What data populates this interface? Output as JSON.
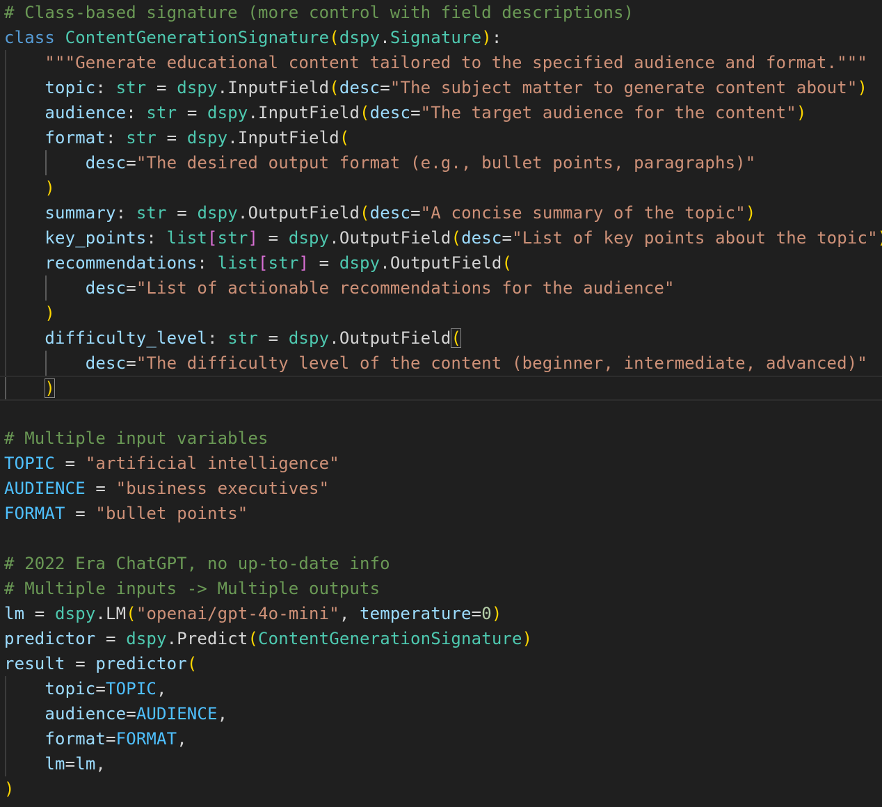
{
  "editor": {
    "language": "python",
    "colors": {
      "background": "#1f1f1f",
      "comment": "#6a9955",
      "keyword": "#569cd6",
      "class": "#4ec9b0",
      "variable": "#9cdcfe",
      "constant": "#4fc1ff",
      "string": "#ce9178",
      "number": "#b5cea8",
      "function": "#dcdcaa",
      "paren": "#ffd700",
      "bracket": "#da70d6",
      "plain": "#d4d4d4"
    },
    "lines": [
      {
        "guides": [],
        "tokens": [
          {
            "t": "comment",
            "v": "# Class-based signature (more control with field descriptions)"
          }
        ]
      },
      {
        "guides": [],
        "tokens": [
          {
            "t": "keyword",
            "v": "class"
          },
          {
            "t": "plain",
            "v": " "
          },
          {
            "t": "class",
            "v": "ContentGenerationSignature"
          },
          {
            "t": "paren",
            "v": "("
          },
          {
            "t": "class",
            "v": "dspy"
          },
          {
            "t": "plain",
            "v": "."
          },
          {
            "t": "class",
            "v": "Signature"
          },
          {
            "t": "paren",
            "v": ")"
          },
          {
            "t": "plain",
            "v": ":"
          }
        ]
      },
      {
        "guides": [
          1
        ],
        "tokens": [
          {
            "t": "plain",
            "v": "    "
          },
          {
            "t": "string",
            "v": "\"\"\"Generate educational content tailored to the specified audience and format.\"\"\""
          }
        ]
      },
      {
        "guides": [
          1
        ],
        "tokens": [
          {
            "t": "plain",
            "v": "    "
          },
          {
            "t": "var",
            "v": "topic"
          },
          {
            "t": "plain",
            "v": ": "
          },
          {
            "t": "class",
            "v": "str"
          },
          {
            "t": "plain",
            "v": " = "
          },
          {
            "t": "class",
            "v": "dspy"
          },
          {
            "t": "plain",
            "v": "."
          },
          {
            "t": "plain",
            "v": "InputField"
          },
          {
            "t": "paren",
            "v": "("
          },
          {
            "t": "var",
            "v": "desc"
          },
          {
            "t": "plain",
            "v": "="
          },
          {
            "t": "string",
            "v": "\"The subject matter to generate content about\""
          },
          {
            "t": "paren",
            "v": ")"
          }
        ]
      },
      {
        "guides": [
          1
        ],
        "tokens": [
          {
            "t": "plain",
            "v": "    "
          },
          {
            "t": "var",
            "v": "audience"
          },
          {
            "t": "plain",
            "v": ": "
          },
          {
            "t": "class",
            "v": "str"
          },
          {
            "t": "plain",
            "v": " = "
          },
          {
            "t": "class",
            "v": "dspy"
          },
          {
            "t": "plain",
            "v": "."
          },
          {
            "t": "plain",
            "v": "InputField"
          },
          {
            "t": "paren",
            "v": "("
          },
          {
            "t": "var",
            "v": "desc"
          },
          {
            "t": "plain",
            "v": "="
          },
          {
            "t": "string",
            "v": "\"The target audience for the content\""
          },
          {
            "t": "paren",
            "v": ")"
          }
        ]
      },
      {
        "guides": [
          1
        ],
        "tokens": [
          {
            "t": "plain",
            "v": "    "
          },
          {
            "t": "var",
            "v": "format"
          },
          {
            "t": "plain",
            "v": ": "
          },
          {
            "t": "class",
            "v": "str"
          },
          {
            "t": "plain",
            "v": " = "
          },
          {
            "t": "class",
            "v": "dspy"
          },
          {
            "t": "plain",
            "v": "."
          },
          {
            "t": "plain",
            "v": "InputField"
          },
          {
            "t": "paren",
            "v": "("
          }
        ]
      },
      {
        "guides": [
          1,
          2
        ],
        "tokens": [
          {
            "t": "plain",
            "v": "        "
          },
          {
            "t": "var",
            "v": "desc"
          },
          {
            "t": "plain",
            "v": "="
          },
          {
            "t": "string",
            "v": "\"The desired output format (e.g., bullet points, paragraphs)\""
          }
        ]
      },
      {
        "guides": [
          1
        ],
        "tokens": [
          {
            "t": "plain",
            "v": "    "
          },
          {
            "t": "paren",
            "v": ")"
          }
        ]
      },
      {
        "guides": [
          1
        ],
        "tokens": [
          {
            "t": "plain",
            "v": "    "
          },
          {
            "t": "var",
            "v": "summary"
          },
          {
            "t": "plain",
            "v": ": "
          },
          {
            "t": "class",
            "v": "str"
          },
          {
            "t": "plain",
            "v": " = "
          },
          {
            "t": "class",
            "v": "dspy"
          },
          {
            "t": "plain",
            "v": "."
          },
          {
            "t": "plain",
            "v": "OutputField"
          },
          {
            "t": "paren",
            "v": "("
          },
          {
            "t": "var",
            "v": "desc"
          },
          {
            "t": "plain",
            "v": "="
          },
          {
            "t": "string",
            "v": "\"A concise summary of the topic\""
          },
          {
            "t": "paren",
            "v": ")"
          }
        ]
      },
      {
        "guides": [
          1
        ],
        "tokens": [
          {
            "t": "plain",
            "v": "    "
          },
          {
            "t": "var",
            "v": "key_points"
          },
          {
            "t": "plain",
            "v": ": "
          },
          {
            "t": "class",
            "v": "list"
          },
          {
            "t": "bracket",
            "v": "["
          },
          {
            "t": "class",
            "v": "str"
          },
          {
            "t": "bracket",
            "v": "]"
          },
          {
            "t": "plain",
            "v": " = "
          },
          {
            "t": "class",
            "v": "dspy"
          },
          {
            "t": "plain",
            "v": "."
          },
          {
            "t": "plain",
            "v": "OutputField"
          },
          {
            "t": "paren",
            "v": "("
          },
          {
            "t": "var",
            "v": "desc"
          },
          {
            "t": "plain",
            "v": "="
          },
          {
            "t": "string",
            "v": "\"List of key points about the topic\""
          },
          {
            "t": "paren",
            "v": ")"
          }
        ]
      },
      {
        "guides": [
          1
        ],
        "tokens": [
          {
            "t": "plain",
            "v": "    "
          },
          {
            "t": "var",
            "v": "recommendations"
          },
          {
            "t": "plain",
            "v": ": "
          },
          {
            "t": "class",
            "v": "list"
          },
          {
            "t": "bracket",
            "v": "["
          },
          {
            "t": "class",
            "v": "str"
          },
          {
            "t": "bracket",
            "v": "]"
          },
          {
            "t": "plain",
            "v": " = "
          },
          {
            "t": "class",
            "v": "dspy"
          },
          {
            "t": "plain",
            "v": "."
          },
          {
            "t": "plain",
            "v": "OutputField"
          },
          {
            "t": "paren",
            "v": "("
          }
        ]
      },
      {
        "guides": [
          1,
          2
        ],
        "tokens": [
          {
            "t": "plain",
            "v": "        "
          },
          {
            "t": "var",
            "v": "desc"
          },
          {
            "t": "plain",
            "v": "="
          },
          {
            "t": "string",
            "v": "\"List of actionable recommendations for the audience\""
          }
        ]
      },
      {
        "guides": [
          1
        ],
        "tokens": [
          {
            "t": "plain",
            "v": "    "
          },
          {
            "t": "paren",
            "v": ")"
          }
        ]
      },
      {
        "guides": [
          1
        ],
        "tokens": [
          {
            "t": "plain",
            "v": "    "
          },
          {
            "t": "var",
            "v": "difficulty_level"
          },
          {
            "t": "plain",
            "v": ": "
          },
          {
            "t": "class",
            "v": "str"
          },
          {
            "t": "plain",
            "v": " = "
          },
          {
            "t": "class",
            "v": "dspy"
          },
          {
            "t": "plain",
            "v": "."
          },
          {
            "t": "plain",
            "v": "OutputField"
          },
          {
            "t": "paren",
            "v": "(",
            "match": true
          }
        ]
      },
      {
        "guides": [
          1,
          2
        ],
        "tokens": [
          {
            "t": "plain",
            "v": "        "
          },
          {
            "t": "var",
            "v": "desc"
          },
          {
            "t": "plain",
            "v": "="
          },
          {
            "t": "string",
            "v": "\"The difficulty level of the content (beginner, intermediate, advanced)\""
          }
        ]
      },
      {
        "guides": [
          1
        ],
        "current": true,
        "tokens": [
          {
            "t": "plain",
            "v": "    "
          },
          {
            "t": "paren",
            "v": ")",
            "match": true
          }
        ]
      },
      {
        "guides": [],
        "tokens": []
      },
      {
        "guides": [],
        "tokens": [
          {
            "t": "comment",
            "v": "# Multiple input variables"
          }
        ]
      },
      {
        "guides": [],
        "tokens": [
          {
            "t": "const",
            "v": "TOPIC"
          },
          {
            "t": "plain",
            "v": " = "
          },
          {
            "t": "string",
            "v": "\"artificial intelligence\""
          }
        ]
      },
      {
        "guides": [],
        "tokens": [
          {
            "t": "const",
            "v": "AUDIENCE"
          },
          {
            "t": "plain",
            "v": " = "
          },
          {
            "t": "string",
            "v": "\"business executives\""
          }
        ]
      },
      {
        "guides": [],
        "tokens": [
          {
            "t": "const",
            "v": "FORMAT"
          },
          {
            "t": "plain",
            "v": " = "
          },
          {
            "t": "string",
            "v": "\"bullet points\""
          }
        ]
      },
      {
        "guides": [],
        "tokens": []
      },
      {
        "guides": [],
        "tokens": [
          {
            "t": "comment",
            "v": "# 2022 Era ChatGPT, no up-to-date info"
          }
        ]
      },
      {
        "guides": [],
        "tokens": [
          {
            "t": "comment",
            "v": "# Multiple inputs -> Multiple outputs"
          }
        ]
      },
      {
        "guides": [],
        "tokens": [
          {
            "t": "var",
            "v": "lm"
          },
          {
            "t": "plain",
            "v": " = "
          },
          {
            "t": "class",
            "v": "dspy"
          },
          {
            "t": "plain",
            "v": "."
          },
          {
            "t": "plain",
            "v": "LM"
          },
          {
            "t": "paren",
            "v": "("
          },
          {
            "t": "string",
            "v": "\"openai/gpt-4o-mini\""
          },
          {
            "t": "plain",
            "v": ", "
          },
          {
            "t": "var",
            "v": "temperature"
          },
          {
            "t": "plain",
            "v": "="
          },
          {
            "t": "number",
            "v": "0"
          },
          {
            "t": "paren",
            "v": ")"
          }
        ]
      },
      {
        "guides": [],
        "tokens": [
          {
            "t": "var",
            "v": "predictor"
          },
          {
            "t": "plain",
            "v": " = "
          },
          {
            "t": "class",
            "v": "dspy"
          },
          {
            "t": "plain",
            "v": "."
          },
          {
            "t": "plain",
            "v": "Predict"
          },
          {
            "t": "paren",
            "v": "("
          },
          {
            "t": "class",
            "v": "ContentGenerationSignature"
          },
          {
            "t": "paren",
            "v": ")"
          }
        ]
      },
      {
        "guides": [],
        "tokens": [
          {
            "t": "var",
            "v": "result"
          },
          {
            "t": "plain",
            "v": " = "
          },
          {
            "t": "var",
            "v": "predictor"
          },
          {
            "t": "paren",
            "v": "("
          }
        ]
      },
      {
        "guides": [
          1
        ],
        "tokens": [
          {
            "t": "plain",
            "v": "    "
          },
          {
            "t": "var",
            "v": "topic"
          },
          {
            "t": "plain",
            "v": "="
          },
          {
            "t": "const",
            "v": "TOPIC"
          },
          {
            "t": "plain",
            "v": ","
          }
        ]
      },
      {
        "guides": [
          1
        ],
        "tokens": [
          {
            "t": "plain",
            "v": "    "
          },
          {
            "t": "var",
            "v": "audience"
          },
          {
            "t": "plain",
            "v": "="
          },
          {
            "t": "const",
            "v": "AUDIENCE"
          },
          {
            "t": "plain",
            "v": ","
          }
        ]
      },
      {
        "guides": [
          1
        ],
        "tokens": [
          {
            "t": "plain",
            "v": "    "
          },
          {
            "t": "var",
            "v": "format"
          },
          {
            "t": "plain",
            "v": "="
          },
          {
            "t": "const",
            "v": "FORMAT"
          },
          {
            "t": "plain",
            "v": ","
          }
        ]
      },
      {
        "guides": [
          1
        ],
        "tokens": [
          {
            "t": "plain",
            "v": "    "
          },
          {
            "t": "var",
            "v": "lm"
          },
          {
            "t": "plain",
            "v": "="
          },
          {
            "t": "var",
            "v": "lm"
          },
          {
            "t": "plain",
            "v": ","
          }
        ]
      },
      {
        "guides": [],
        "tokens": [
          {
            "t": "paren",
            "v": ")"
          }
        ]
      }
    ]
  }
}
